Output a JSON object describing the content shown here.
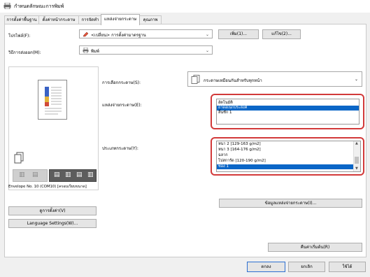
{
  "window": {
    "title": "กำหนดลักษณะการพิมพ์"
  },
  "tabs": [
    {
      "label": "การตั้งค่าพื้นฐาน"
    },
    {
      "label": "ตั้งค่าหน้ากระดาษ"
    },
    {
      "label": "การจัดทำ"
    },
    {
      "label": "แหล่งจ่ายกระดาษ"
    },
    {
      "label": "คุณภาพ"
    }
  ],
  "active_tab_index": 3,
  "profile": {
    "label": "โปรไฟล์(F):",
    "value": "<เปลี่ยน> การตั้งค่ามาตรฐาน",
    "add_button": "เพิ่ม(1)...",
    "edit_button": "แก้ไข(2)..."
  },
  "output_method": {
    "label": "วิธีการส่งออก(M):",
    "value": "พิมพ์"
  },
  "paper_selection": {
    "label": "การเลือกกระดาษ(S):",
    "value": "กระดาษเหมือนกันสำหรับทุกหน้า"
  },
  "paper_source": {
    "label": "แหล่งจ่ายกระดาษ(E):",
    "items": [
      "อัตโนมัติ",
      "ถาดอเนกประสงค์",
      "ลิ้นชัก 1"
    ],
    "selected_index": 1
  },
  "paper_type": {
    "label": "ประเภทกระดาษ(Y):",
    "items": [
      "หนา 2 [129-163 g/m2]",
      "หนา 3 [164-176 g/m2]",
      "ฉลาก",
      "โปสการ์ด [120-190 g/m2]",
      "ซอง 1"
    ],
    "selected_index": 4
  },
  "paper_source_info_button": "ข้อมูลแหล่งจ่ายกระดาษ(I)...",
  "preview": {
    "caption": "Envelope No. 10 (COM10) [ครอบเรียบขนาด]"
  },
  "left_buttons": {
    "view_settings": "ดูการตั้งค่า(V)",
    "language_settings": "Language Settings(W)..."
  },
  "restore_defaults_button": "คืนค่าเริ่มต้น(R)",
  "bottom_buttons": {
    "ok": "ตกลง",
    "cancel": "ยกเลิก",
    "apply": "ใช้ได้"
  },
  "colors": {
    "selection": "#0a66c7",
    "highlight": "#d23a3a"
  }
}
